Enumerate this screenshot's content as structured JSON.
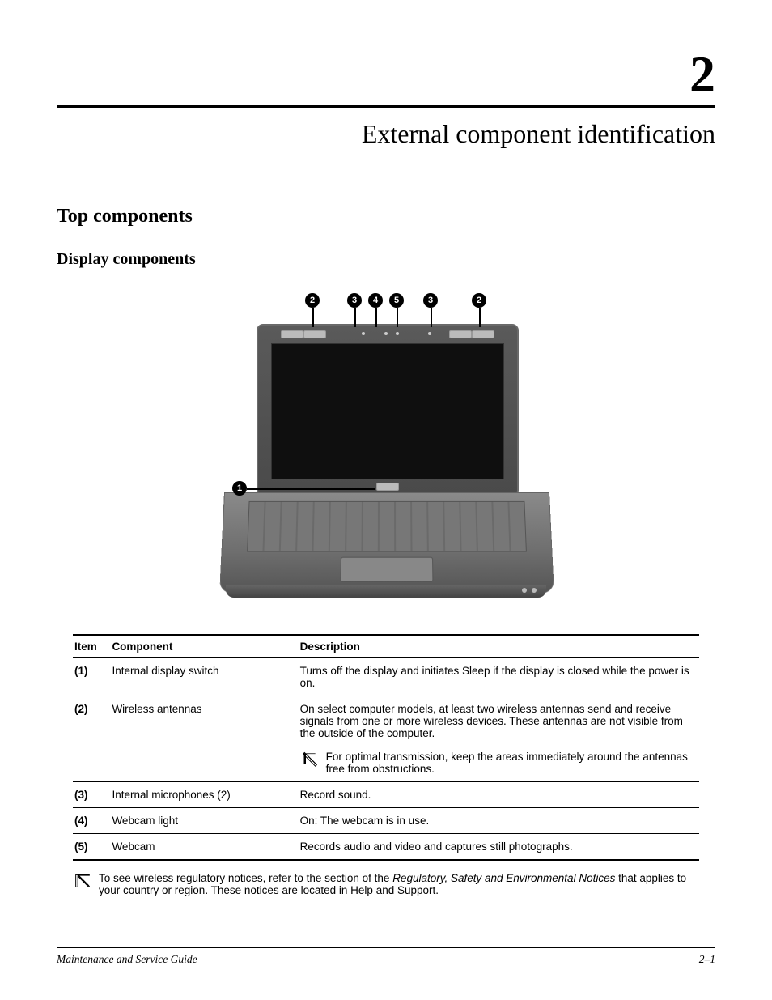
{
  "chapterNumber": "2",
  "chapterTitle": "External component identification",
  "section1": "Top components",
  "section2": "Display components",
  "callouts": {
    "c1": "1",
    "c2a": "2",
    "c2b": "2",
    "c3a": "3",
    "c3b": "3",
    "c4": "4",
    "c5": "5"
  },
  "tableHeaders": {
    "item": "Item",
    "component": "Component",
    "description": "Description"
  },
  "rows": [
    {
      "item": "(1)",
      "component": "Internal display switch",
      "description": "Turns off the display and initiates Sleep if the display is closed while the power is on."
    },
    {
      "item": "(2)",
      "component": "Wireless antennas",
      "description": "On select computer models, at least two wireless antennas send and receive signals from one or more wireless devices. These antennas are not visible from the outside of the computer.",
      "note": "For optimal transmission, keep the areas immediately around the antennas free from obstructions."
    },
    {
      "item": "(3)",
      "component": "Internal microphones (2)",
      "description": "Record sound."
    },
    {
      "item": "(4)",
      "component": "Webcam light",
      "description": "On: The webcam is in use."
    },
    {
      "item": "(5)",
      "component": "Webcam",
      "description": "Records audio and video and captures still photographs."
    }
  ],
  "footnote": {
    "pre": "To see wireless regulatory notices, refer to the section of the ",
    "italic": "Regulatory, Safety and Environmental Notices",
    "post": " that applies to your country or region. These notices are located in Help and Support."
  },
  "footer": {
    "left": "Maintenance and Service Guide",
    "right": "2–1"
  }
}
